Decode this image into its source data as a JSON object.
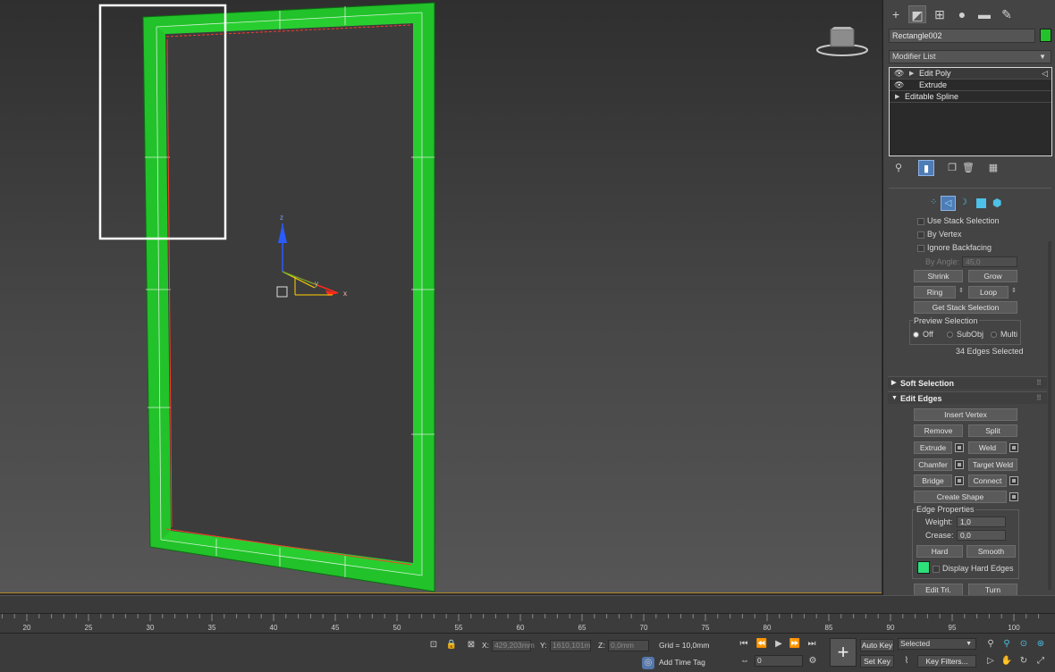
{
  "object": {
    "name": "Rectangle002",
    "color": "#23c42b"
  },
  "modifier_list": {
    "label": "Modifier List"
  },
  "stack": {
    "items": [
      {
        "label": "Edit Poly",
        "visible": true,
        "expandable": true,
        "selected": true
      },
      {
        "label": "Extrude",
        "visible": true,
        "expandable": false,
        "selected": false
      },
      {
        "label": "Editable Spline",
        "visible": false,
        "expandable": true,
        "selected": false
      }
    ]
  },
  "viewport": {
    "axis_x": "x",
    "axis_y": "y",
    "axis_z": "z"
  },
  "selection": {
    "use_stack_selection": "Use Stack Selection",
    "by_vertex": "By Vertex",
    "ignore_backfacing": "Ignore Backfacing",
    "by_angle_label": "By Angle:",
    "by_angle_value": "45,0",
    "shrink": "Shrink",
    "grow": "Grow",
    "ring": "Ring",
    "loop": "Loop",
    "get_stack_selection": "Get Stack Selection",
    "preview_label": "Preview Selection",
    "preview_off": "Off",
    "preview_subobj": "SubObj",
    "preview_multi": "Multi",
    "status": "34 Edges Selected"
  },
  "soft_selection": {
    "title": "Soft Selection"
  },
  "edit_edges": {
    "title": "Edit Edges",
    "insert_vertex": "Insert Vertex",
    "remove": "Remove",
    "split": "Split",
    "extrude": "Extrude",
    "weld": "Weld",
    "chamfer": "Chamfer",
    "target_weld": "Target Weld",
    "bridge": "Bridge",
    "connect": "Connect",
    "create_shape": "Create Shape",
    "edge_properties": "Edge Properties",
    "weight_label": "Weight:",
    "weight_value": "1,0",
    "crease_label": "Crease:",
    "crease_value": "0,0",
    "hard": "Hard",
    "smooth": "Smooth",
    "display_hard_edges": "Display Hard Edges",
    "edit_tri": "Edit Tri.",
    "turn": "Turn",
    "hard_edge_color": "#2ee07a"
  },
  "trackbar": {
    "ticks": [
      "20",
      "25",
      "30",
      "35",
      "40",
      "45",
      "50",
      "55",
      "60",
      "65",
      "70",
      "75",
      "80",
      "85",
      "90",
      "95",
      "100"
    ]
  },
  "status_bar": {
    "x_label": "X:",
    "x_value": "429,203mm",
    "y_label": "Y:",
    "y_value": "1610,101m",
    "z_label": "Z:",
    "z_value": "0,0mm",
    "grid": "Grid = 10,0mm",
    "add_time_tag": "Add Time Tag",
    "frame": "0",
    "auto_key": "Auto Key",
    "set_key": "Set Key",
    "selected": "Selected",
    "key_filters": "Key Filters..."
  }
}
